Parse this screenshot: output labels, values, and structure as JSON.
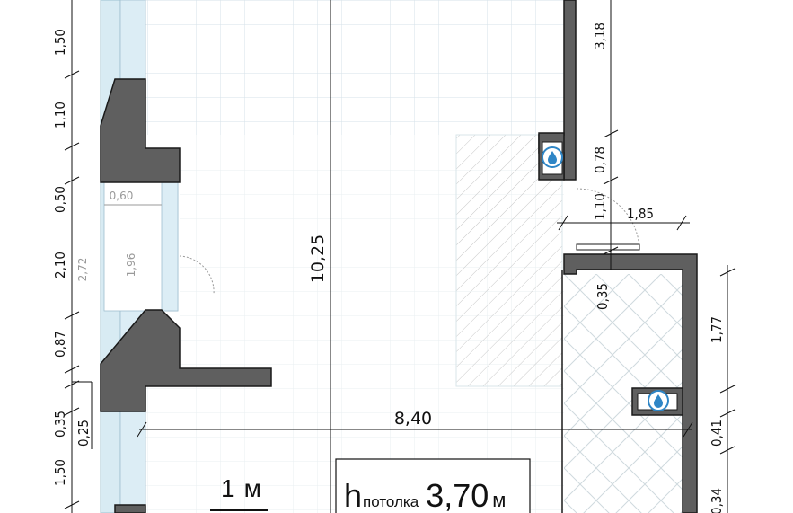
{
  "colors": {
    "wall": "#5f5f5f",
    "wall_stroke": "#1a1a1a",
    "window_glass": "#d8ebf3",
    "grid_line": "#d6e2e8",
    "water_icon": "#2f86c6",
    "dimension_line": "#111111"
  },
  "dimensions": {
    "left_col": [
      "1,50",
      "1,10",
      "0,50",
      "2,10",
      "0,87",
      "0,35",
      "0,25",
      "1,50"
    ],
    "window_gray": [
      "0,60",
      "2,72",
      "1,96"
    ],
    "right_col": [
      "3,18",
      "0,78",
      "1,10",
      "1,85",
      "0,35"
    ],
    "far_right": [
      "1,77",
      "0,41",
      "0,34"
    ],
    "center_vertical": "10,25",
    "horizontal": "8,40"
  },
  "scale_label": {
    "value": "1",
    "unit": "м"
  },
  "ceiling": {
    "prefix": "h",
    "subscript": "потолка",
    "value": "3,70",
    "unit": "м"
  },
  "icons": {
    "riser_1": "water-drop-icon",
    "riser_2": "water-drop-icon"
  }
}
